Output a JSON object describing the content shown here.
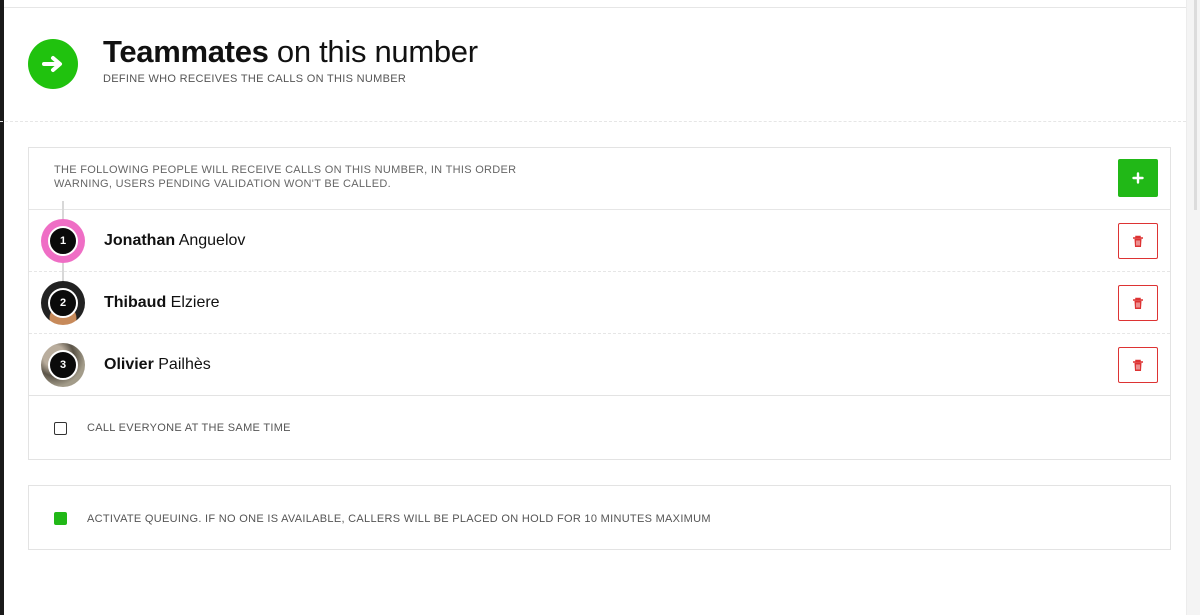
{
  "header": {
    "title_strong": "Teammates",
    "title_rest": " on this number",
    "subtitle": "DEFINE WHO RECEIVES THE CALLS ON THIS NUMBER",
    "icon": "arrow-right-icon"
  },
  "order_panel": {
    "info_line1": "THE FOLLOWING PEOPLE WILL RECEIVE CALLS ON THIS NUMBER, IN THIS ORDER",
    "info_line2": "WARNING, USERS PENDING VALIDATION WON'T BE CALLED.",
    "add_icon": "plus-icon",
    "members": [
      {
        "order": "1",
        "first_name": "Jonathan",
        "last_name": " Anguelov"
      },
      {
        "order": "2",
        "first_name": "Thibaud",
        "last_name": " Elziere"
      },
      {
        "order": "3",
        "first_name": "Olivier",
        "last_name": " Pailhès"
      }
    ],
    "delete_icon": "trash-icon",
    "simultaneous": {
      "label": "CALL EVERYONE AT THE SAME TIME",
      "checked": false
    }
  },
  "queuing": {
    "label": "ACTIVATE QUEUING. IF NO ONE IS AVAILABLE, CALLERS WILL BE PLACED ON HOLD FOR 10 MINUTES MAXIMUM",
    "checked": true
  },
  "colors": {
    "accent_green": "#21b817",
    "delete_red": "#d33333",
    "first_avatar_ring": "#ef6ec5"
  }
}
